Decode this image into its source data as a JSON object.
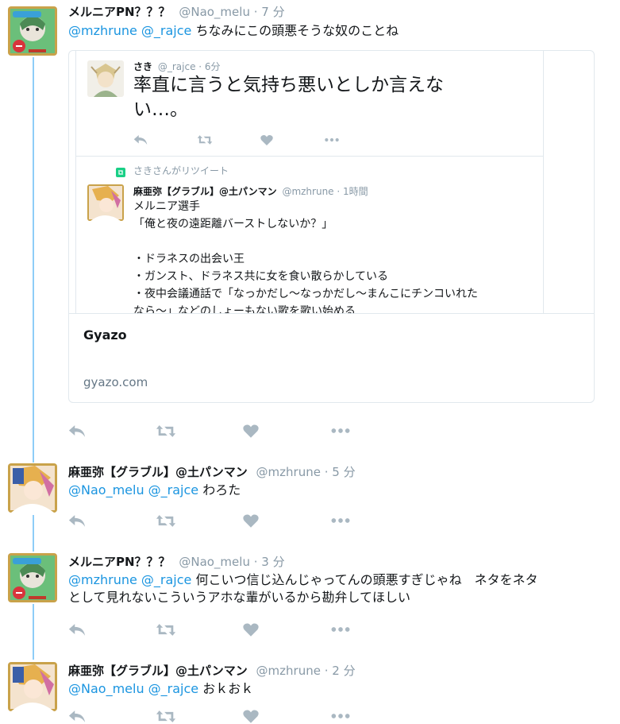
{
  "tweets": [
    {
      "name": "メルニアPN？？？",
      "handle": "@Nao_melu",
      "time": "· 7 分",
      "mentions": "@mzhrune @_rajce",
      "text": " ちなみにこの頭悪そうな奴のことね",
      "avatar": "melunia-avatar"
    },
    {
      "name": "麻亜弥【グラブル】@土パンマン",
      "handle": "@mzhrune",
      "time": "· 5 分",
      "mentions": "@Nao_melu @_rajce",
      "text": " わろた",
      "avatar": "maaya-avatar"
    },
    {
      "name": "メルニアPN？？？",
      "handle": "@Nao_melu",
      "time": "· 3 分",
      "mentions": "@mzhrune @_rajce",
      "text_line1": " 何こいつ信じ込んじゃってんの頭悪すぎじゃね　ネタをネタ",
      "text_line2": "として見れないこういうアホな輩がいるから勘弁してほしい",
      "avatar": "melunia-avatar"
    },
    {
      "name": "麻亜弥【グラブル】@土パンマン",
      "handle": "@mzhrune",
      "time": "· 2 分",
      "mentions": "@Nao_melu @_rajce",
      "text": " おｋおｋ",
      "avatar": "maaya-avatar"
    }
  ],
  "card": {
    "quoted": {
      "name": "さき",
      "handle": "@_rajce",
      "time": "· 6分",
      "text_line1": "率直に言うと気持ち悪いとしか言えな",
      "text_line2": "い…。"
    },
    "retweet_label": "さきさんがリツイート",
    "retweeted": {
      "name": "麻亜弥【グラブル】@土パンマン",
      "handle": "@mzhrune",
      "time": "· 1時間",
      "lines": [
        "メルニア選手",
        "「俺と夜の遠距離バーストしないか？」",
        "",
        "・ドラネスの出会い王",
        "・ガンスト、ドラネス共に女を食い散らかしている",
        "・夜中会議通話で「なっかだし〜なっかだし〜まんこにチンコいれた",
        "なら〜」などのしょーもない歌を歌い始める"
      ]
    },
    "title": "Gyazo",
    "domain": "gyazo.com"
  },
  "icons": [
    "reply-icon",
    "retweet-icon",
    "like-icon",
    "more-icon"
  ],
  "colors": {
    "mention": "#1b95e0",
    "muted": "#8899a6",
    "icon": "#aab8c2",
    "thread_line": "#8ecdf8",
    "border": "#e1e8ed"
  }
}
